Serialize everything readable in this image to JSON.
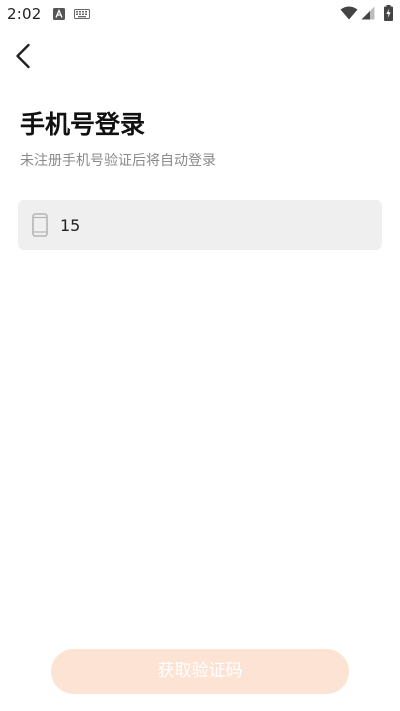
{
  "status_bar": {
    "time": "2:02",
    "icons": [
      "accessibility-icon",
      "keyboard-icon",
      "wifi-icon",
      "signal-icon",
      "battery-charging-icon"
    ]
  },
  "header": {
    "back_icon": "chevron-left-icon"
  },
  "main": {
    "title": "手机号登录",
    "subtitle": "未注册手机号验证后将自动登录",
    "phone_field": {
      "icon": "phone-icon",
      "value": "15"
    }
  },
  "footer": {
    "get_code_label": "获取验证码",
    "button_color": "#fde3d3",
    "button_text_color": "#ffffff"
  }
}
